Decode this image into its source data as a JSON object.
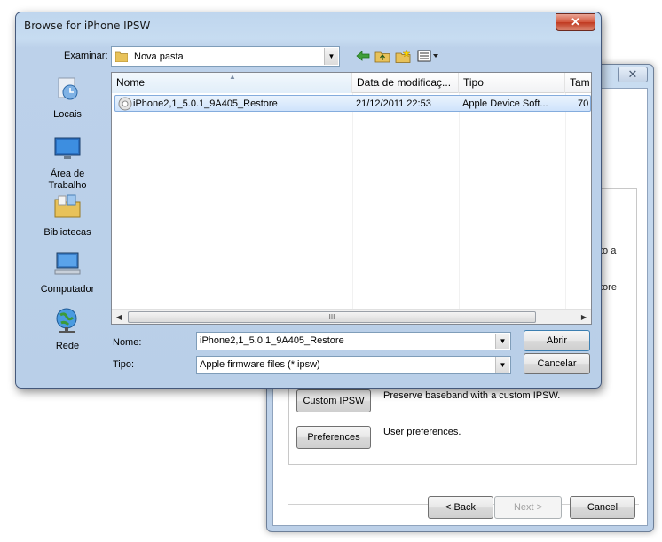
{
  "dialog": {
    "title": "Browse for iPhone IPSW",
    "close_glyph": "✕",
    "look_in_label": "Examinar:",
    "look_in_value": "Nova pasta",
    "toolbar_icons": [
      "back-arrow-icon",
      "up-folder-icon",
      "new-folder-icon",
      "view-menu-icon"
    ],
    "places": [
      {
        "label": "Locais",
        "icon": "recent-places-icon"
      },
      {
        "label": "Área de Trabalho",
        "icon": "desktop-icon"
      },
      {
        "label": "Bibliotecas",
        "icon": "libraries-icon"
      },
      {
        "label": "Computador",
        "icon": "computer-icon"
      },
      {
        "label": "Rede",
        "icon": "network-icon"
      }
    ],
    "columns": [
      "Nome",
      "Data de modificaç...",
      "Tipo",
      "Tam"
    ],
    "files": [
      {
        "name": "iPhone2,1_5.0.1_9A405_Restore",
        "date": "21/12/2011 22:53",
        "type": "Apple Device Soft...",
        "size": "70"
      }
    ],
    "scroll_grip": "III",
    "name_label": "Nome:",
    "name_value": "iPhone2,1_5.0.1_9A405_Restore",
    "type_label": "Tipo:",
    "type_value": "Apple firmware files (*.ipsw)",
    "open_button": "Abrir",
    "cancel_button": "Cancelar"
  },
  "wizard": {
    "close_glyph": "✕",
    "fragment_1": "to a",
    "fragment_2": "tore",
    "custom_ipsw_button": "Custom IPSW",
    "custom_ipsw_desc": "Preserve baseband with a custom IPSW.",
    "preferences_button": "Preferences",
    "preferences_desc": "User preferences.",
    "back_button": "< Back",
    "next_button": "Next >",
    "cancel_button": "Cancel"
  },
  "colors": {
    "selection": "#cfe3fb",
    "title_bar": "#bfd6ee",
    "close_button": "#c03a20"
  }
}
